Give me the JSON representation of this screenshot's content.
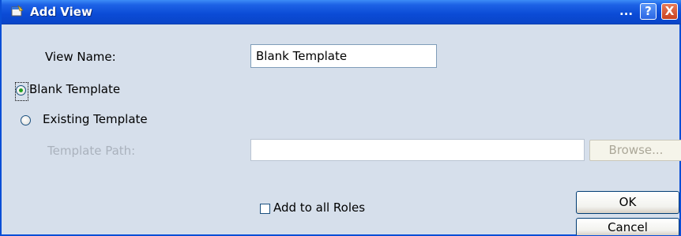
{
  "window": {
    "title": "Add View",
    "title_extra": "...",
    "help_button": "?",
    "close_button": "X"
  },
  "form": {
    "view_name_label": "View Name:",
    "view_name_value": "Blank Template",
    "radio_blank_label": "Blank Template",
    "radio_blank_selected": true,
    "radio_existing_label": "Existing Template",
    "radio_existing_selected": false,
    "template_path_label": "Template Path:",
    "template_path_value": "",
    "browse_button": "Browse...",
    "add_all_roles_label": "Add to all Roles",
    "add_all_roles_checked": false
  },
  "buttons": {
    "ok": "OK",
    "cancel": "Cancel"
  },
  "colors": {
    "titlebar": "#0b4bd6",
    "dialog_bg": "#d6dfeb",
    "radio_selected_dot": "#21a121"
  }
}
